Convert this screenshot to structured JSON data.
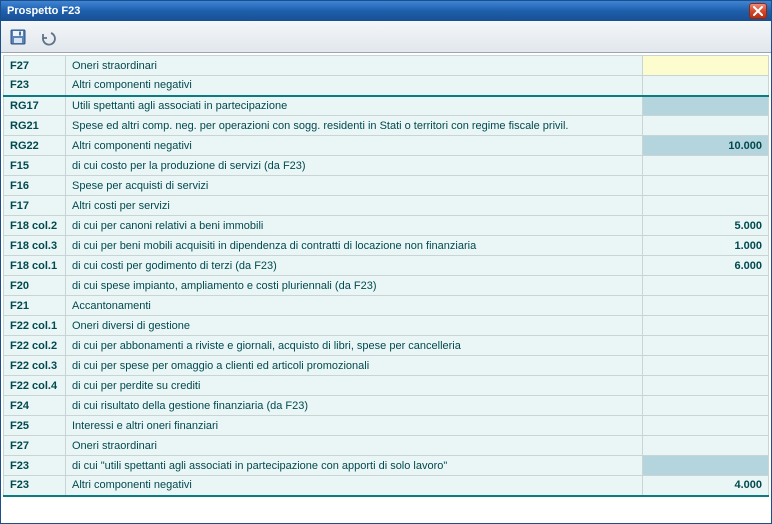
{
  "window": {
    "title": "Prospetto F23"
  },
  "toolbar": {
    "save_tooltip": "Salva",
    "undo_tooltip": "Annulla"
  },
  "rows": [
    {
      "code": "F27",
      "desc": "Oneri straordinari",
      "value": "",
      "val_yellow": true,
      "sep_below": false
    },
    {
      "code": "F23",
      "desc": "Altri componenti negativi",
      "value": "",
      "val_hl": false,
      "sep_below": true
    },
    {
      "code": "RG17",
      "desc": "Utili spettanti agli associati in partecipazione",
      "value": "",
      "val_hl": true
    },
    {
      "code": "RG21",
      "desc": "Spese ed altri comp. neg. per operazioni con sogg. residenti in Stati o territori con regime fiscale privil.",
      "value": ""
    },
    {
      "code": "RG22",
      "desc": "Altri componenti negativi",
      "value": "10.000",
      "val_hl": true
    },
    {
      "code": "F15",
      "desc": "di cui costo per la produzione di servizi (da F23)",
      "value": ""
    },
    {
      "code": "F16",
      "desc": "Spese per acquisti di servizi",
      "value": ""
    },
    {
      "code": "F17",
      "desc": "Altri costi per servizi",
      "value": ""
    },
    {
      "code": "F18 col.2",
      "desc": "di cui per canoni relativi a beni immobili",
      "value": "5.000"
    },
    {
      "code": "F18 col.3",
      "desc": "di cui per beni mobili acquisiti in dipendenza di contratti di locazione non finanziaria",
      "value": "1.000"
    },
    {
      "code": "F18 col.1",
      "desc": "di cui costi per godimento di terzi (da F23)",
      "value": "6.000"
    },
    {
      "code": "F20",
      "desc": "di cui spese impianto, ampliamento e costi pluriennali (da F23)",
      "value": ""
    },
    {
      "code": "F21",
      "desc": "Accantonamenti",
      "value": ""
    },
    {
      "code": "F22  col.1",
      "desc": "Oneri diversi di gestione",
      "value": ""
    },
    {
      "code": "F22  col.2",
      "desc": "di cui per abbonamenti a riviste e giornali, acquisto di libri, spese per cancelleria",
      "value": ""
    },
    {
      "code": "F22  col.3",
      "desc": "di cui per spese per omaggio a clienti ed articoli promozionali",
      "value": ""
    },
    {
      "code": "F22  col.4",
      "desc": "di cui per perdite su crediti",
      "value": ""
    },
    {
      "code": "F24",
      "desc": "di cui risultato della gestione finanziaria (da F23)",
      "value": ""
    },
    {
      "code": "F25",
      "desc": "Interessi e altri oneri finanziari",
      "value": ""
    },
    {
      "code": "F27",
      "desc": "Oneri straordinari",
      "value": ""
    },
    {
      "code": "F23",
      "desc": "di cui \"utili spettanti agli associati in partecipazione con apporti di solo lavoro\"",
      "value": "",
      "val_hl": true
    },
    {
      "code": "F23",
      "desc": "Altri componenti negativi",
      "value": "4.000",
      "sep_below": true
    }
  ]
}
